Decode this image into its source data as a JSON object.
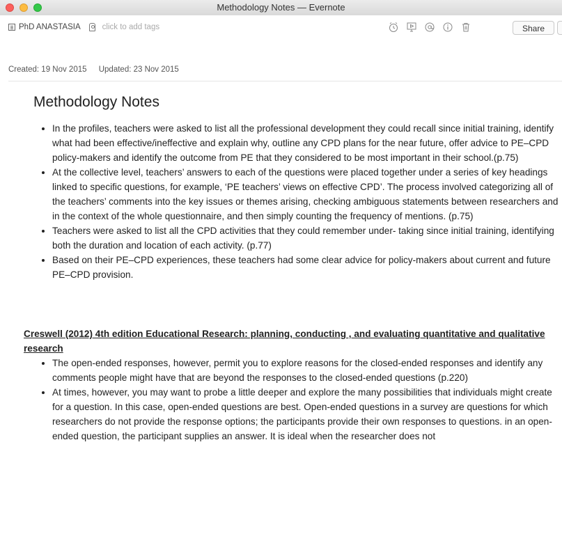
{
  "window": {
    "title": "Methodology Notes — Evernote"
  },
  "toolbar": {
    "notebook": "PhD ANASTASIA",
    "tags_placeholder": "click to add tags",
    "share_label": "Share",
    "icons": [
      "notebook-icon",
      "tag-icon",
      "reminder-icon",
      "presentation-icon",
      "mention-icon",
      "info-icon",
      "trash-icon"
    ]
  },
  "meta": {
    "created": "Created: 19 Nov 2015",
    "updated": "Updated: 23 Nov 2015"
  },
  "note": {
    "title": "Methodology Notes",
    "bullets1": [
      "In the profiles, teachers were asked to list all the professional development they could recall since initial training, identify what had been effective/ineffective and explain why, outline any CPD plans for the near future, offer advice to PE–CPD policy-makers and identify the outcome from PE that they considered to be most important in their school.(p.75)",
      "At the collective level, teachers’ answers to each of the questions were placed together under a series of key headings linked to specific questions, for example, ‘PE teachers’ views on effective CPD’. The process involved categorizing all of the teachers’ comments into the key issues or themes arising, checking ambiguous statements between researchers and in the context of the whole questionnaire, and then simply counting the frequency of mentions. (p.75)",
      "Teachers were asked to list all the CPD activities that they could remember under- taking since initial training, identifying both the duration and location of each activity. (p.77)",
      "Based on their PE–CPD experiences, these teachers had some clear advice for policy-makers about current and future PE–CPD provision."
    ],
    "section2_heading": "Creswell (2012) 4th edition Educational Research: planning, conducting , and evaluating quantitative and qualitative research",
    "bullets2": [
      "The open-ended responses, however, permit you to explore reasons for the closed-ended responses and identify any comments people might have that are beyond the responses to the closed-ended questions (p.220)",
      "At times, however, you may want to probe a little deeper and explore the many possibilities that individuals might create for a question. In this case, open-ended questions are best. Open-ended questions in a survey are questions for which researchers do not provide the response options; the participants provide their own responses to questions. in an open-ended question, the participant supplies an answer. It is ideal when the researcher does not"
    ]
  }
}
